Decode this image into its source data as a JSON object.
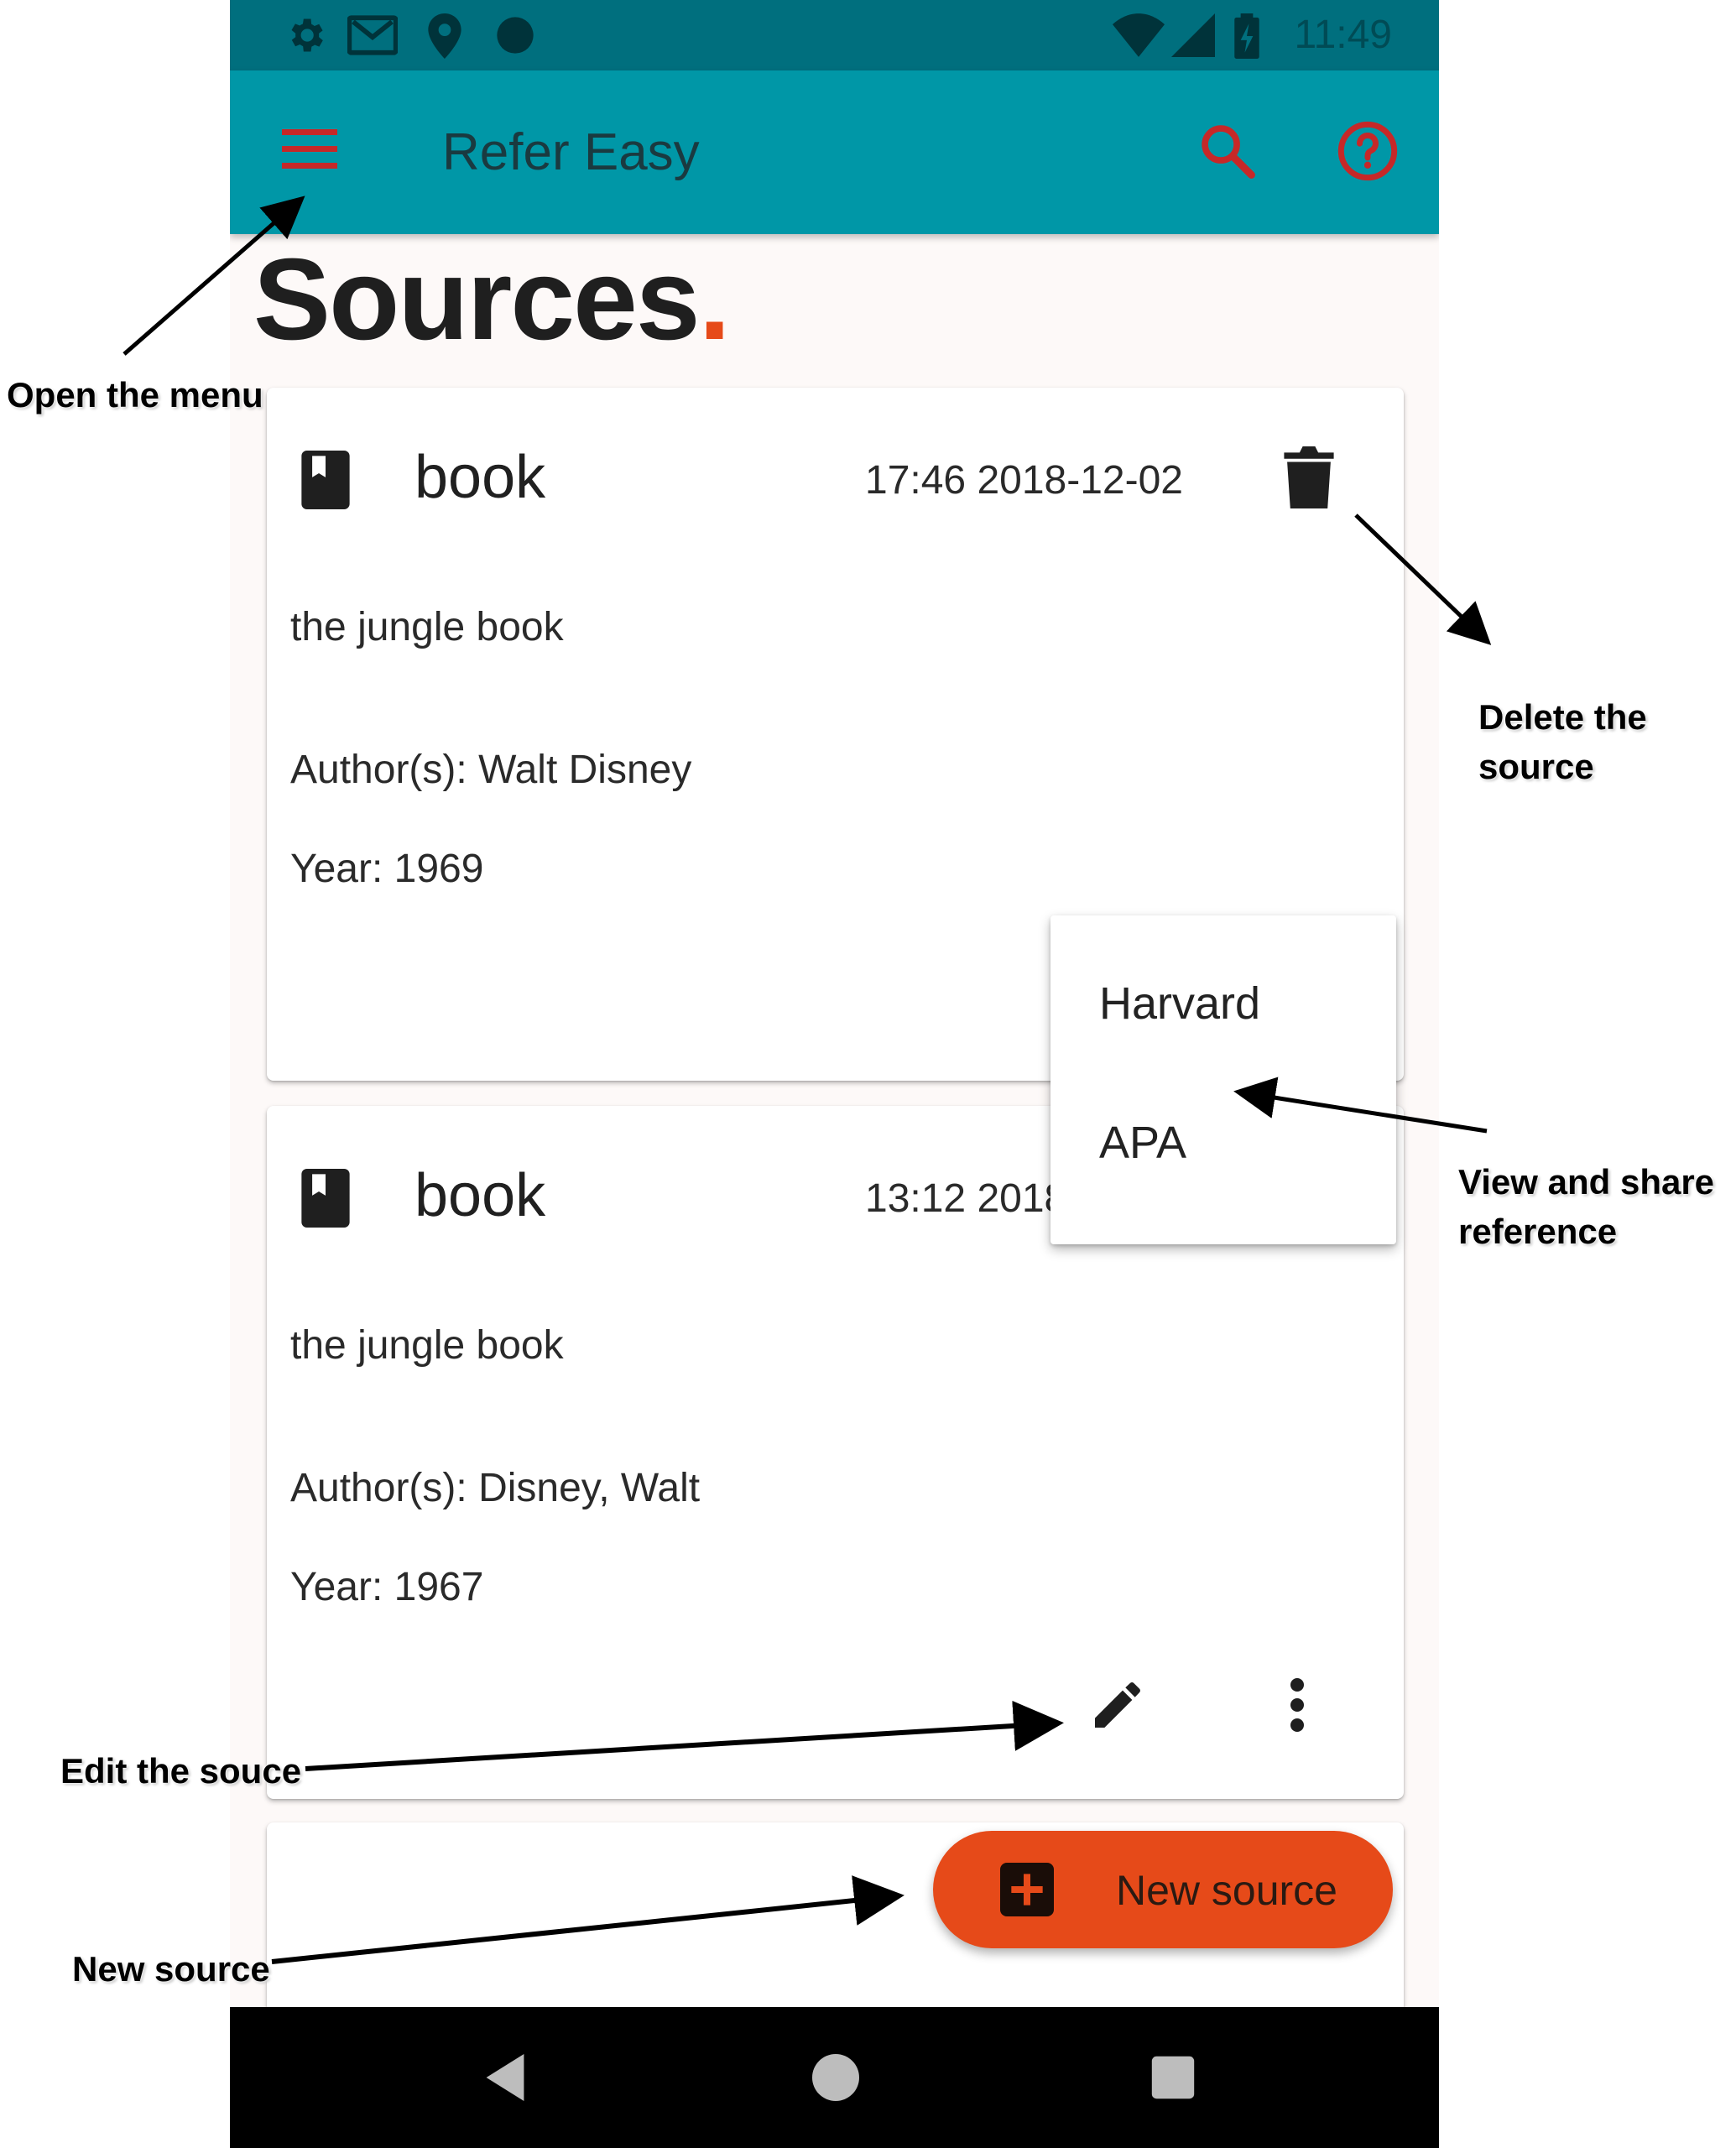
{
  "status_bar": {
    "time": "11:49",
    "left_icons": [
      "gear-icon",
      "gmail-icon",
      "location-icon",
      "circle-icon"
    ],
    "right_icons": [
      "wifi-icon",
      "signal-icon",
      "battery-charging-icon"
    ]
  },
  "app_bar": {
    "title": "Refer Easy",
    "menu_icon": "hamburger-menu-icon",
    "search_icon": "search-icon",
    "help_icon": "help-circle-icon",
    "icon_color": "#c62828",
    "background": "#0097a7"
  },
  "page": {
    "title": "Sources",
    "title_dot": "."
  },
  "sources": [
    {
      "type": "book",
      "timestamp": "17:46 2018-12-02",
      "title": "the jungle book",
      "authors": "Author(s): Walt Disney",
      "year": "Year: 1969"
    },
    {
      "type": "book",
      "timestamp": "13:12 2018-12-02",
      "title": "the jungle book",
      "authors": "Author(s): Disney, Walt",
      "year": "Year: 1967"
    }
  ],
  "reference_menu": {
    "items": [
      "Harvard",
      "APA"
    ]
  },
  "fab": {
    "label": "New source",
    "icon": "add-box-icon",
    "color": "#e64a19"
  },
  "nav_bar": {
    "buttons": [
      "back-icon",
      "home-icon",
      "recents-icon"
    ]
  },
  "annotations": {
    "open_menu": "Open the menu",
    "delete_source_line1": "Delete the",
    "delete_source_line2": "source",
    "view_share_line1": "View and share",
    "view_share_line2": "reference",
    "edit_source": "Edit the souce",
    "new_source": "New source"
  }
}
